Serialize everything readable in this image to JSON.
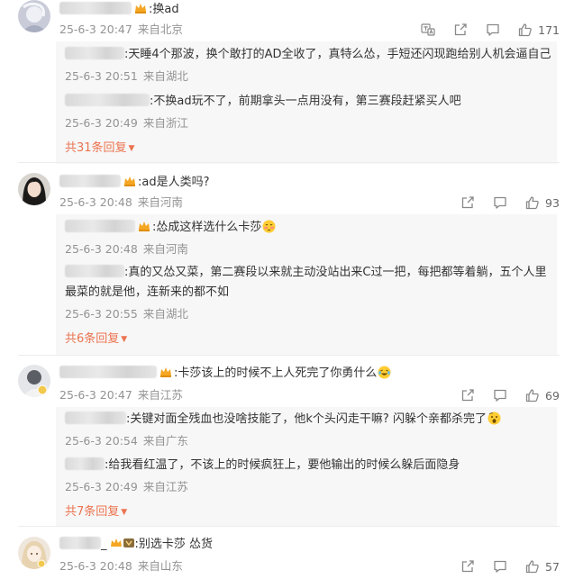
{
  "comments": [
    {
      "text": ":换ad",
      "meta": {
        "date": "25-6-3 20:47",
        "location": "来自北京"
      },
      "likes": "171",
      "replies": [
        {
          "text": ":天睡4个那波，换个敢打的AD全收了，真特么怂，手短还闪现跑给别人机会逼自己",
          "meta": {
            "date": "25-6-3 20:51",
            "location": "来自湖北"
          }
        },
        {
          "text": ":不换ad玩不了，前期拿头一点用没有，第三赛段赶紧买人吧",
          "meta": {
            "date": "25-6-3 20:49",
            "location": "来自浙江"
          }
        }
      ],
      "more_label": "共31条回复"
    },
    {
      "text": ":ad是人类吗?",
      "meta": {
        "date": "25-6-3 20:48",
        "location": "来自河南"
      },
      "likes": "93",
      "replies": [
        {
          "text": ":怂成这样选什么卡莎",
          "meta": {
            "date": "25-6-3 20:48",
            "location": "来自河南"
          }
        },
        {
          "text_line1": ":真的又怂又菜，第二赛段以来就主动没站出来C过一把，每把都等着躺，五个人里",
          "text_line2": "最菜的就是他，连新来的都不如",
          "meta": {
            "date": "25-6-3 20:55",
            "location": "来自湖北"
          }
        }
      ],
      "more_label": "共6条回复"
    },
    {
      "text": ":卡莎该上的时候不上人死完了你勇什么",
      "meta": {
        "date": "25-6-3 20:47",
        "location": "来自江苏"
      },
      "likes": "69",
      "replies": [
        {
          "text": ":关键对面全残血也没啥技能了，他k个头闪走干嘛? 闪躲个亲都杀完了",
          "meta": {
            "date": "25-6-3 20:54",
            "location": "来自广东"
          }
        },
        {
          "text": ":给我看红温了，不该上的时候疯狂上，要他输出的时候么躲后面隐身",
          "meta": {
            "date": "25-6-3 20:49",
            "location": "来自江苏"
          }
        }
      ],
      "more_label": "共7条回复"
    },
    {
      "text": ":别选卡莎 怂货",
      "meta": {
        "date": "25-6-3 20:48",
        "location": "来自山东"
      },
      "likes": "57"
    }
  ],
  "icons": {
    "translate": "translate-icon",
    "share": "share-icon",
    "comment": "comment-icon",
    "like": "thumbs-up-icon",
    "crown": "crown-badge-icon",
    "more": "caret-down-icon"
  },
  "colors": {
    "link_orange": "#eb7350",
    "meta_gray": "#939393",
    "reply_bg": "#f7f7f7"
  }
}
